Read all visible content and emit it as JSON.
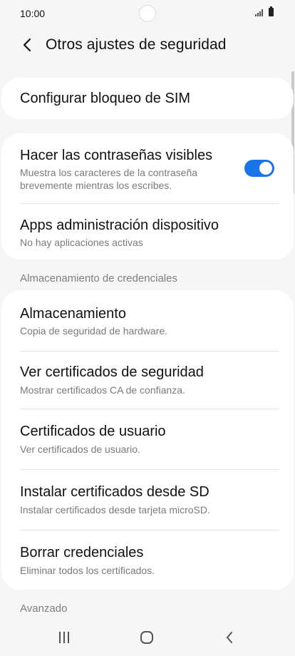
{
  "status_bar": {
    "time": "10:00"
  },
  "header": {
    "title": "Otros ajustes de seguridad"
  },
  "card_sim": {
    "title": "Configurar bloqueo de SIM"
  },
  "card_visibility": {
    "items": [
      {
        "title": "Hacer las contraseñas visibles",
        "subtitle_line1": "Muestra los caracteres de la contraseña",
        "subtitle_line2": "brevemente mientras los escribes.",
        "toggle_on": true
      },
      {
        "title": "Apps administración dispositivo",
        "subtitle": "No hay aplicaciones activas"
      }
    ]
  },
  "section_credentials": {
    "label": "Almacenamiento de credenciales"
  },
  "card_credentials": {
    "items": [
      {
        "title": "Almacenamiento",
        "subtitle": "Copia de seguridad de hardware."
      },
      {
        "title": "Ver certificados de seguridad",
        "subtitle": "Mostrar certificados CA de confianza."
      },
      {
        "title": "Certificados de usuario",
        "subtitle": "Ver certificados de usuario."
      },
      {
        "title": "Instalar certificados desde SD",
        "subtitle": "Instalar certificados desde tarjeta microSD."
      },
      {
        "title": "Borrar credenciales",
        "subtitle": "Eliminar todos los certificados."
      }
    ]
  },
  "section_advanced": {
    "label": "Avanzado"
  },
  "colors": {
    "accent": "#1a73e8",
    "background": "#f6f6f6",
    "card": "#ffffff"
  }
}
